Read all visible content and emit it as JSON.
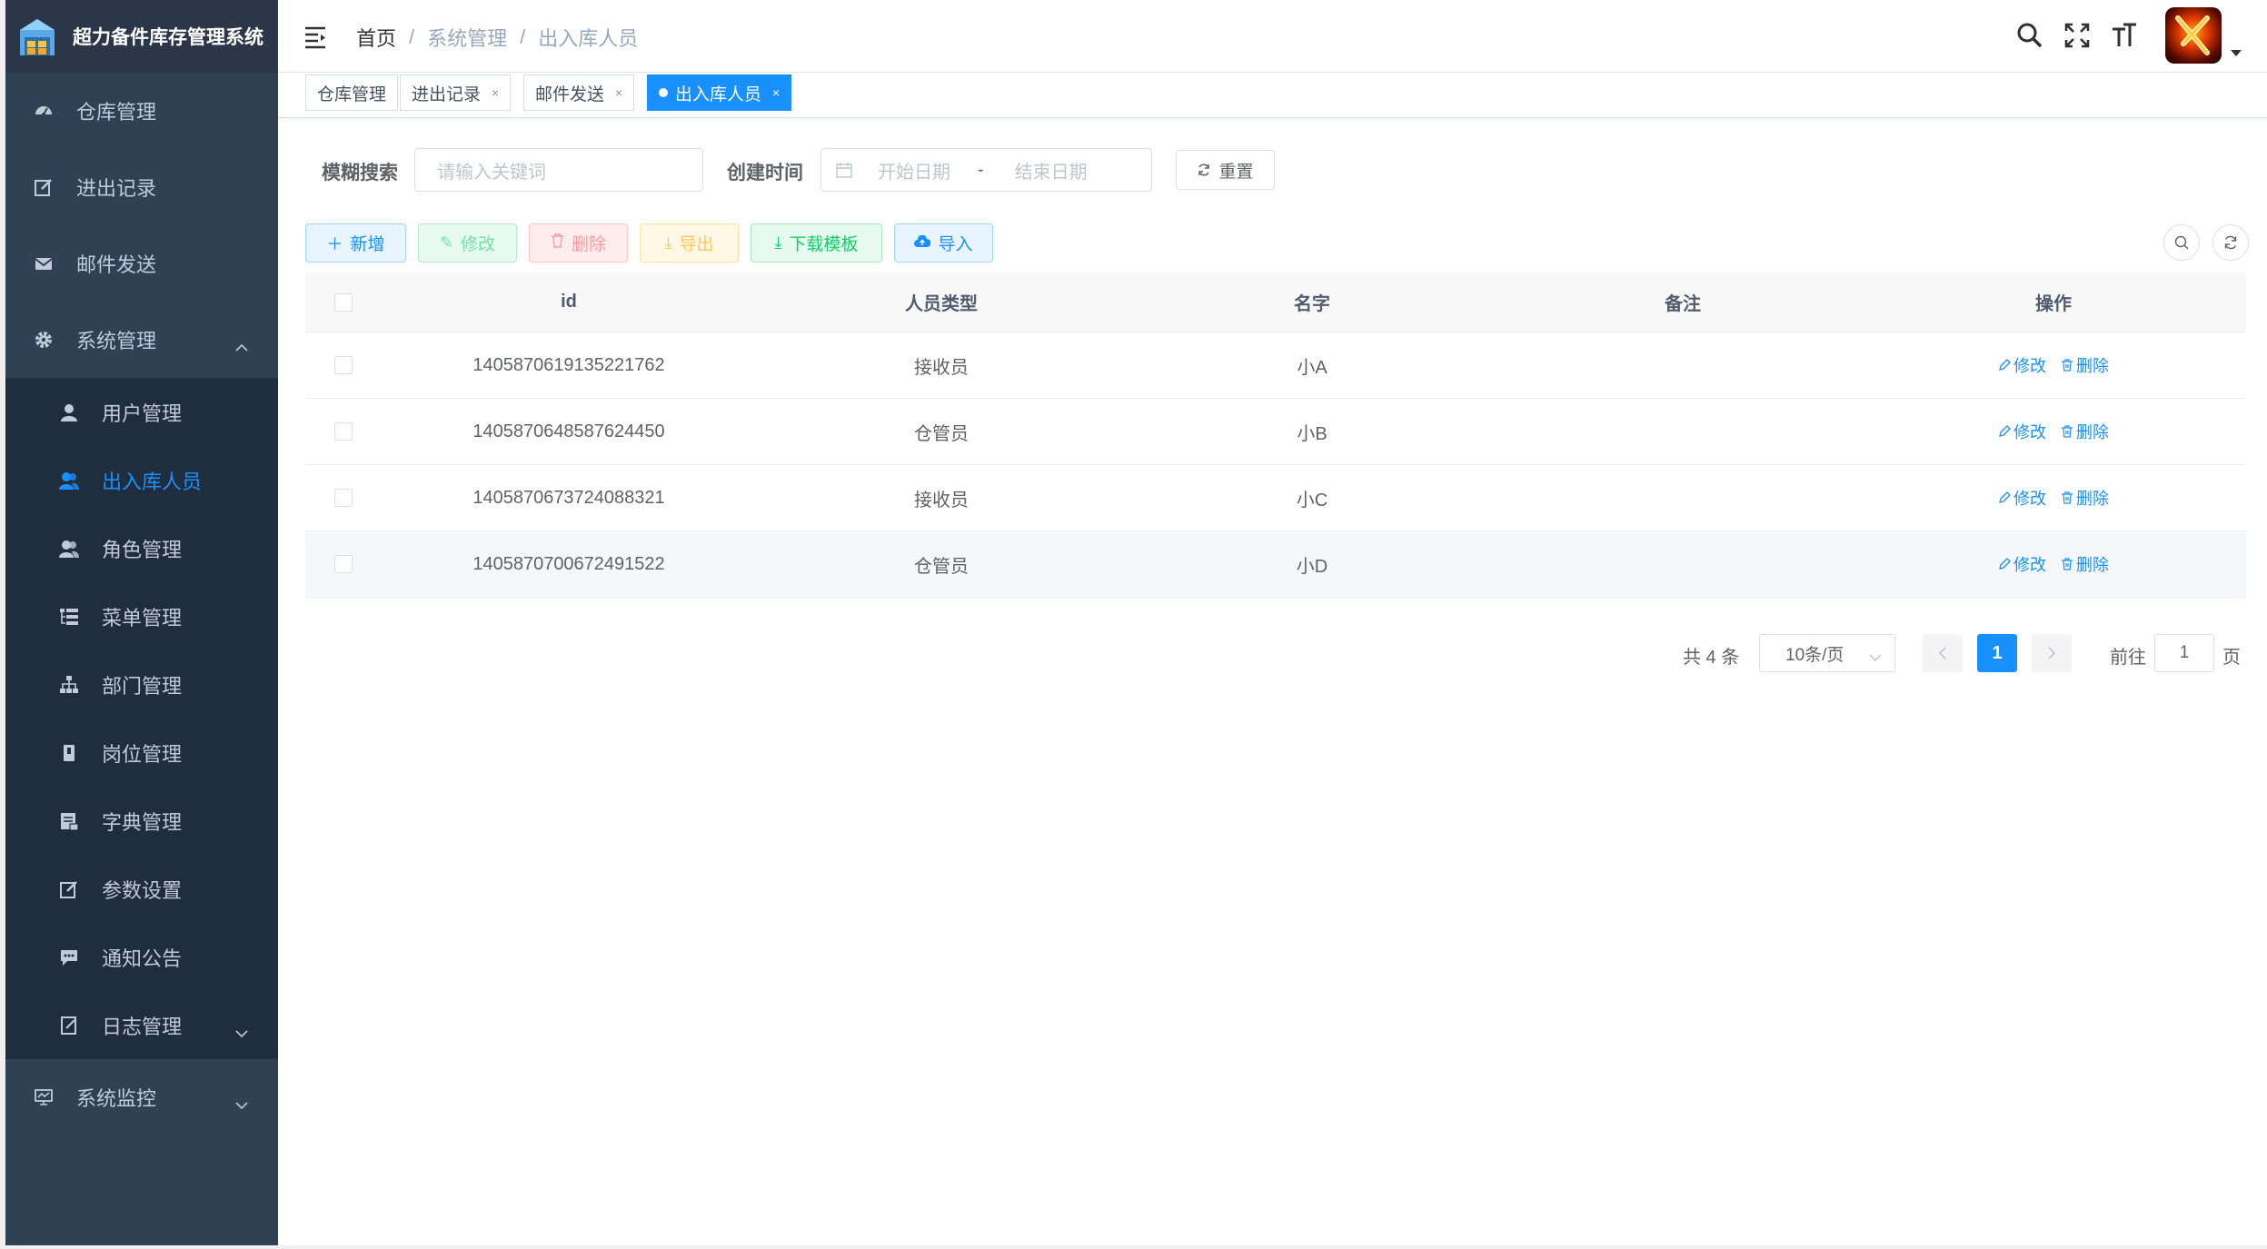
{
  "app": {
    "title": "超力备件库存管理系统"
  },
  "sidebar": {
    "items": [
      {
        "label": "仓库管理",
        "icon": "dashboard-icon"
      },
      {
        "label": "进出记录",
        "icon": "edit-icon"
      },
      {
        "label": "邮件发送",
        "icon": "mail-icon"
      },
      {
        "label": "系统管理",
        "icon": "gear-icon",
        "expanded": true
      }
    ],
    "submenu": [
      {
        "label": "用户管理",
        "icon": "user-icon"
      },
      {
        "label": "出入库人员",
        "icon": "peoples-icon",
        "active": true
      },
      {
        "label": "角色管理",
        "icon": "peoples-icon"
      },
      {
        "label": "菜单管理",
        "icon": "tree-table-icon"
      },
      {
        "label": "部门管理",
        "icon": "tree-icon"
      },
      {
        "label": "岗位管理",
        "icon": "post-icon"
      },
      {
        "label": "字典管理",
        "icon": "dict-icon"
      },
      {
        "label": "参数设置",
        "icon": "edit-icon"
      },
      {
        "label": "通知公告",
        "icon": "message-icon"
      },
      {
        "label": "日志管理",
        "icon": "log-icon"
      }
    ],
    "bottom": [
      {
        "label": "系统监控",
        "icon": "monitor-icon"
      }
    ]
  },
  "breadcrumb": [
    "首页",
    "系统管理",
    "出入库人员"
  ],
  "tags": [
    {
      "label": "仓库管理",
      "closable": false
    },
    {
      "label": "进出记录",
      "closable": true
    },
    {
      "label": "邮件发送",
      "closable": true
    },
    {
      "label": "出入库人员",
      "closable": true,
      "active": true
    }
  ],
  "tag_close": "×",
  "search": {
    "keyword_label": "模糊搜索",
    "keyword_placeholder": "请输入关键词",
    "date_label": "创建时间",
    "start_placeholder": "开始日期",
    "date_sep": "-",
    "end_placeholder": "结束日期",
    "reset_label": "重置"
  },
  "toolbar": {
    "add": "新增",
    "edit": "修改",
    "delete": "删除",
    "export": "导出",
    "download_template": "下载模板",
    "import": "导入"
  },
  "table": {
    "columns": [
      "id",
      "人员类型",
      "名字",
      "备注",
      "操作"
    ],
    "rows": [
      {
        "id": "1405870619135221762",
        "type": "接收员",
        "name": "小A",
        "remark": ""
      },
      {
        "id": "1405870648587624450",
        "type": "仓管员",
        "name": "小B",
        "remark": ""
      },
      {
        "id": "1405870673724088321",
        "type": "接收员",
        "name": "小C",
        "remark": ""
      },
      {
        "id": "1405870700672491522",
        "type": "仓管员",
        "name": "小D",
        "remark": ""
      }
    ],
    "row_actions": {
      "edit": "修改",
      "delete": "删除"
    }
  },
  "pagination": {
    "total_text": "共 4 条",
    "page_size": "10条/页",
    "current_page": "1",
    "goto_label": "前往",
    "goto_value": "1",
    "page_unit": "页"
  },
  "colors": {
    "sidebar_bg": "#304156",
    "submenu_bg": "#1f2d3d",
    "primary": "#1890ff"
  }
}
